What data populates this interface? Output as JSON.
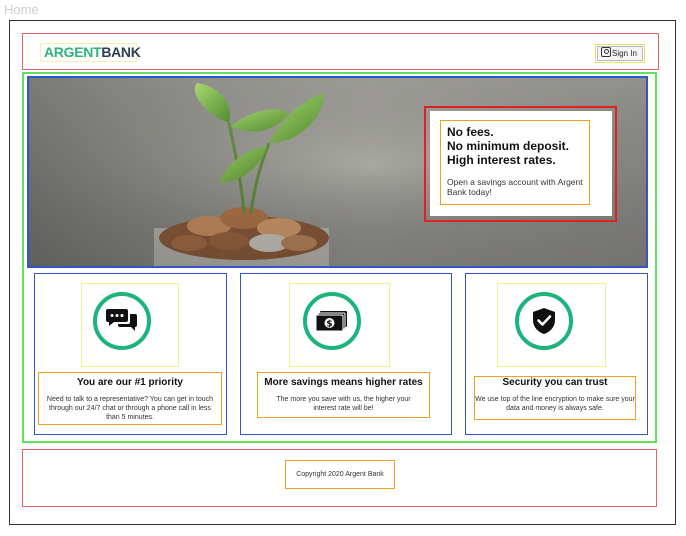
{
  "page": {
    "label": "Home"
  },
  "header": {
    "logo_part1": "ARGENT",
    "logo_part2": "BANK",
    "signin_label": "Sign In"
  },
  "hero": {
    "headline_1": "No fees.",
    "headline_2": "No minimum deposit.",
    "headline_3": "High interest rates.",
    "subtext": "Open a savings account with Argent Bank today!"
  },
  "features": [
    {
      "icon": "chat-icon",
      "title": "You are our #1 priority",
      "body": "Need to talk to a representative? You can get in touch through our 24/7 chat or through a phone call in less than 5 minutes."
    },
    {
      "icon": "money-icon",
      "title": "More savings means higher rates",
      "body": "The more you save with us, the higher your interest rate will be!"
    },
    {
      "icon": "security-icon",
      "title": "Security you can trust",
      "body": "We use top of the line encryption to make sure your data and money is always safe."
    }
  ],
  "footer": {
    "copyright": "Copyright 2020 Argent Bank"
  },
  "colors": {
    "accent": "#1cb47a",
    "brand_dark": "#2c3e50",
    "brand_green": "#2fb27b"
  }
}
